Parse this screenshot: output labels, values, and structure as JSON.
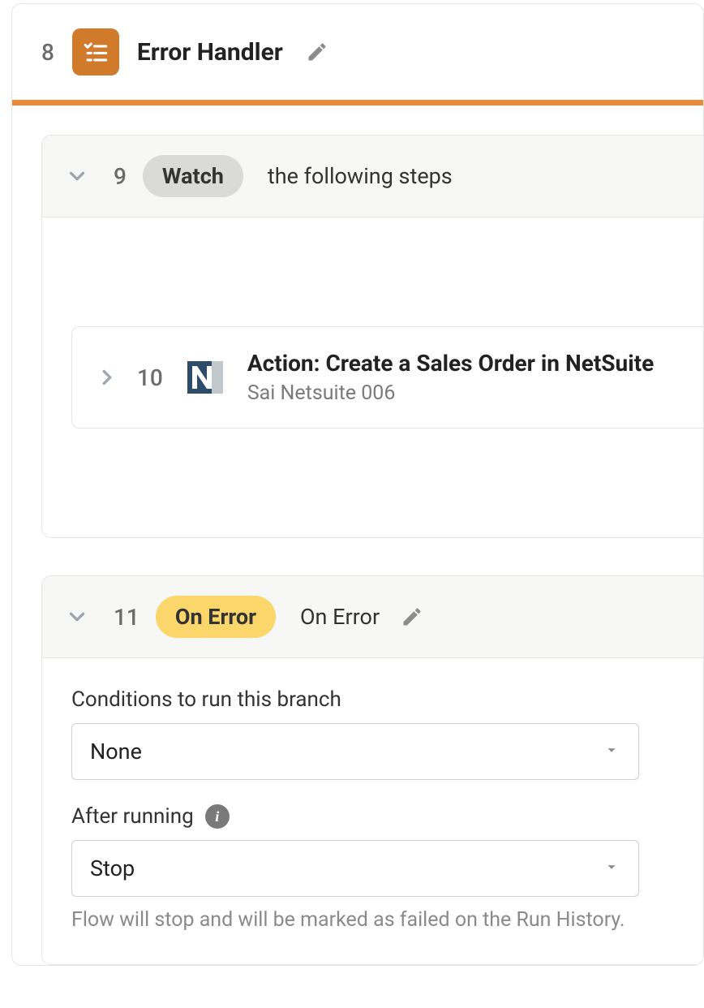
{
  "header": {
    "step_number": "8",
    "title": "Error Handler"
  },
  "watch_section": {
    "step_number": "9",
    "pill_label": "Watch",
    "description": "the following steps",
    "action": {
      "step_number": "10",
      "title": "Action: Create a Sales Order in NetSuite",
      "subtitle": "Sai Netsuite 006"
    }
  },
  "error_section": {
    "step_number": "11",
    "pill_label": "On Error",
    "description": "On Error",
    "fields": {
      "conditions_label": "Conditions to run this branch",
      "conditions_value": "None",
      "after_running_label": "After running",
      "after_running_value": "Stop",
      "after_running_helper": "Flow will stop and will be marked as failed on the Run History."
    }
  }
}
